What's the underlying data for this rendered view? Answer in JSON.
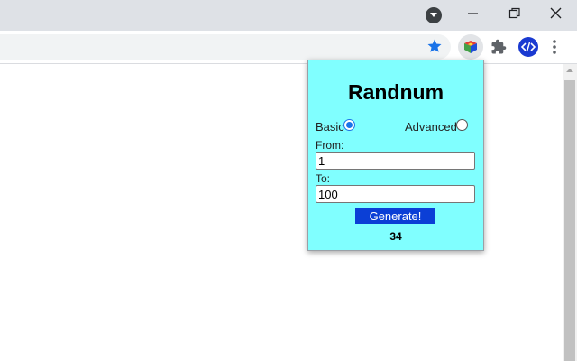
{
  "popup": {
    "title": "Randnum",
    "mode": {
      "basic_label": "Basic",
      "advanced_label": "Advanced",
      "selected": "Basic"
    },
    "from": {
      "label": "From:",
      "value": "1"
    },
    "to": {
      "label": "To:",
      "value": "100"
    },
    "generate_label": "Generate!",
    "result": "34"
  },
  "icons": {
    "tab_search": "chevron-down-icon",
    "minimize": "minimize-icon",
    "restore": "restore-icon",
    "close": "close-icon",
    "bookmark": "star-icon",
    "extension": "randnum-extension-icon",
    "extensions_menu": "puzzle-icon",
    "devtools_ext": "code-icon",
    "menu": "kebab-menu-icon"
  },
  "colors": {
    "popup_background": "#80ffff",
    "generate_button": "#0b3fd6",
    "bookmark_star": "#1a73e8"
  }
}
